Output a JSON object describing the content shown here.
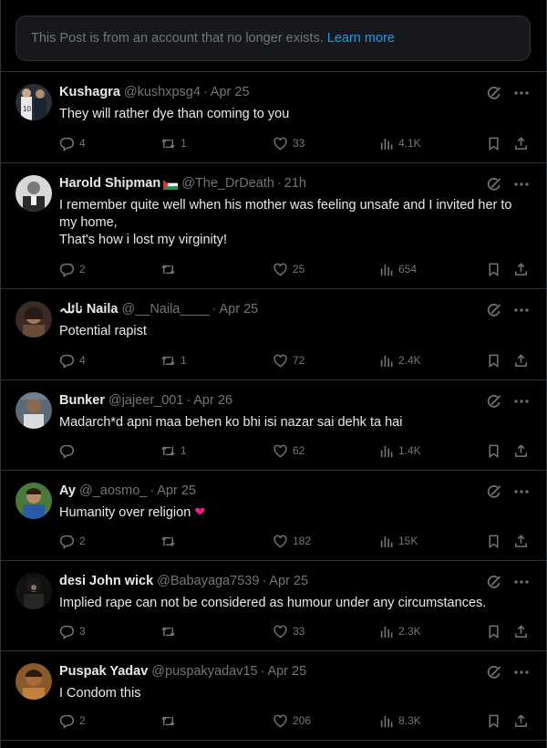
{
  "notice": {
    "text": "This Post is from an account that no longer exists.",
    "link": "Learn more"
  },
  "replies": [
    {
      "name": "Kushagra",
      "handle": "@kushxpsg4",
      "date": "Apr 25",
      "lines": [
        "They will rather dye than coming to you"
      ],
      "reply_count": "4",
      "retweet_count": "1",
      "like_count": "33",
      "view_count": "4.1K"
    },
    {
      "name": "Harold Shipman",
      "handle": "@The_DrDeath",
      "date": "21h",
      "lines": [
        "I remember quite well when his mother was feeling unsafe and I invited her to",
        "my home,",
        "That's how i lost my virginity!"
      ],
      "reply_count": "2",
      "retweet_count": "",
      "like_count": "25",
      "view_count": "654"
    },
    {
      "name": "نائلہ Naila",
      "handle": "@__Naila____",
      "date": "Apr 25",
      "lines": [
        "Potential rapist"
      ],
      "reply_count": "4",
      "retweet_count": "1",
      "like_count": "72",
      "view_count": "2.4K"
    },
    {
      "name": "Bunker",
      "handle": "@jajeer_001",
      "date": "Apr 26",
      "lines": [
        "Madarch*d apni maa behen ko bhi isi nazar sai dehk ta hai"
      ],
      "reply_count": "",
      "retweet_count": "1",
      "like_count": "62",
      "view_count": "1.4K"
    },
    {
      "name": "Ay",
      "handle": "@_aosmo_",
      "date": "Apr 25",
      "lines": [
        "Humanity over religion"
      ],
      "emoji": "❤",
      "reply_count": "2",
      "retweet_count": "",
      "like_count": "182",
      "view_count": "15K"
    },
    {
      "name": "desi John wick",
      "handle": "@Babayaga7539",
      "date": "Apr 25",
      "lines": [
        "Implied rape can not be considered as humour under any circumstances."
      ],
      "reply_count": "3",
      "retweet_count": "",
      "like_count": "33",
      "view_count": "2.3K"
    },
    {
      "name": "Puspak Yadav",
      "handle": "@puspakyadav15",
      "date": "Apr 25",
      "lines": [
        "I Condom this"
      ],
      "reply_count": "2",
      "retweet_count": "",
      "like_count": "206",
      "view_count": "8.3K"
    }
  ],
  "separator": "·",
  "icons": {
    "reply": "reply-icon",
    "retweet": "retweet-icon",
    "like": "heart-icon",
    "views": "views-icon",
    "bookmark": "bookmark-icon",
    "share": "share-icon",
    "grok": "grok-icon",
    "more": "more-icon",
    "flag": "palestine-flag-icon"
  },
  "colors": {
    "background": "#000000",
    "border": "#2f3336",
    "text": "#e7e9ea",
    "muted": "#71767b",
    "link": "#1d9bf0",
    "heart_emoji": "#f91880"
  }
}
